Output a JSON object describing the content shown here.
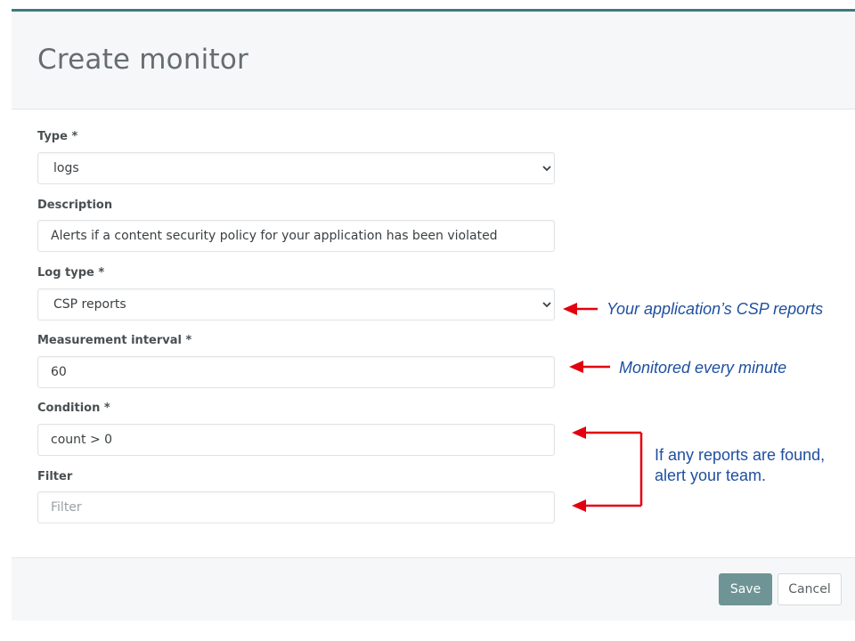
{
  "modal": {
    "title": "Create monitor"
  },
  "form": {
    "type": {
      "label": "Type *",
      "value": "logs",
      "icon": "chevron-down-icon"
    },
    "description": {
      "label": "Description",
      "value": "Alerts if a content security policy for your application has been violated"
    },
    "log_type": {
      "label": "Log type *",
      "value": "CSP reports",
      "icon": "chevron-down-icon"
    },
    "measurement_interval": {
      "label": "Measurement interval *",
      "value": "60"
    },
    "condition": {
      "label": "Condition *",
      "value": "count > 0"
    },
    "filter": {
      "label": "Filter",
      "value": "",
      "placeholder": "Filter"
    }
  },
  "footer": {
    "save_label": "Save",
    "cancel_label": "Cancel"
  },
  "annotations": {
    "csp": "Your application’s CSP reports",
    "interval": "Monitored every minute",
    "alert_line1": "If any reports are found,",
    "alert_line2": "alert your team."
  },
  "colors": {
    "accent": "#3d7a7e",
    "save_button": "#6e9495",
    "arrow": "#e3000f",
    "annotation_text": "#1f4fa0"
  }
}
